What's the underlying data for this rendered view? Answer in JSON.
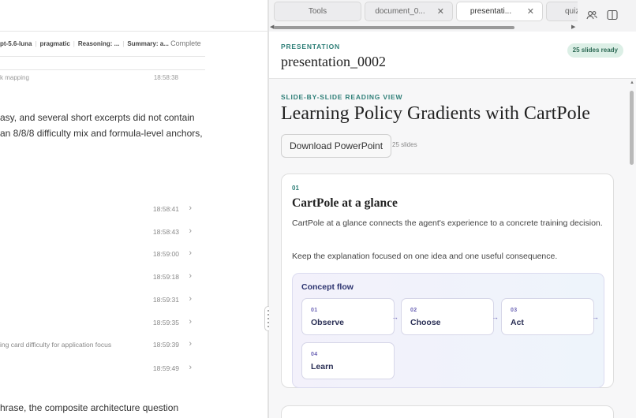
{
  "left": {
    "meta": {
      "model": "pt-5.6-luna",
      "style": "pragmatic",
      "reasoning": "Reasoning: ...",
      "summary": "Summary: a...",
      "status": "Complete"
    },
    "clipped_row": {
      "text": "k mapping",
      "time": "18:58:38"
    },
    "paragraph_lines": [
      "asy, and several short excerpts did not contain",
      "an 8/8/8 difficulty mix and formula-level anchors,"
    ],
    "log_rows": [
      {
        "text": "",
        "time": "18:58:41"
      },
      {
        "text": "",
        "time": "18:58:43"
      },
      {
        "text": "",
        "time": "18:59:00"
      },
      {
        "text": "",
        "time": "18:59:18"
      },
      {
        "text": "",
        "time": "18:59:31"
      },
      {
        "text": "",
        "time": "18:59:35"
      },
      {
        "text": "ing card difficulty for application focus",
        "time": "18:59:39"
      },
      {
        "text": "",
        "time": "18:59:49"
      }
    ],
    "bottom_line": "hrase, the composite architecture question"
  },
  "tabs": [
    {
      "label": "Tools",
      "active": false,
      "closable": false
    },
    {
      "label": "document_0...",
      "active": false,
      "closable": true
    },
    {
      "label": "presentati...",
      "active": true,
      "closable": true
    },
    {
      "label": "quiz",
      "active": false,
      "closable": false
    }
  ],
  "preview": {
    "kind": "PRESENTATION",
    "name": "presentation_0002",
    "ready_badge": "25 slides ready"
  },
  "reading_view": {
    "kind": "SLIDE-BY-SLIDE READING VIEW",
    "title": "Learning Policy Gradients with CartPole",
    "download_label": "Download PowerPoint",
    "slide_count": "25 slides"
  },
  "slide": {
    "number": "01",
    "title": "CartPole at a glance",
    "paragraphs": [
      "CartPole at a glance connects the agent's experience to a concrete training decision.",
      "Keep the explanation focused on one idea and one useful consequence."
    ],
    "flow": {
      "title": "Concept flow",
      "steps": [
        {
          "number": "01",
          "label": "Observe"
        },
        {
          "number": "02",
          "label": "Choose"
        },
        {
          "number": "03",
          "label": "Act"
        },
        {
          "number": "04",
          "label": "Learn"
        }
      ]
    }
  },
  "icons": {
    "people": "people-icon",
    "panel": "panel-toggle-icon",
    "close": "close-icon",
    "chevron": "chevron-right-icon"
  },
  "colors": {
    "accent_teal": "#2f7f78",
    "badge_bg": "#dcefe6",
    "flow_accent": "#6b63b5"
  }
}
